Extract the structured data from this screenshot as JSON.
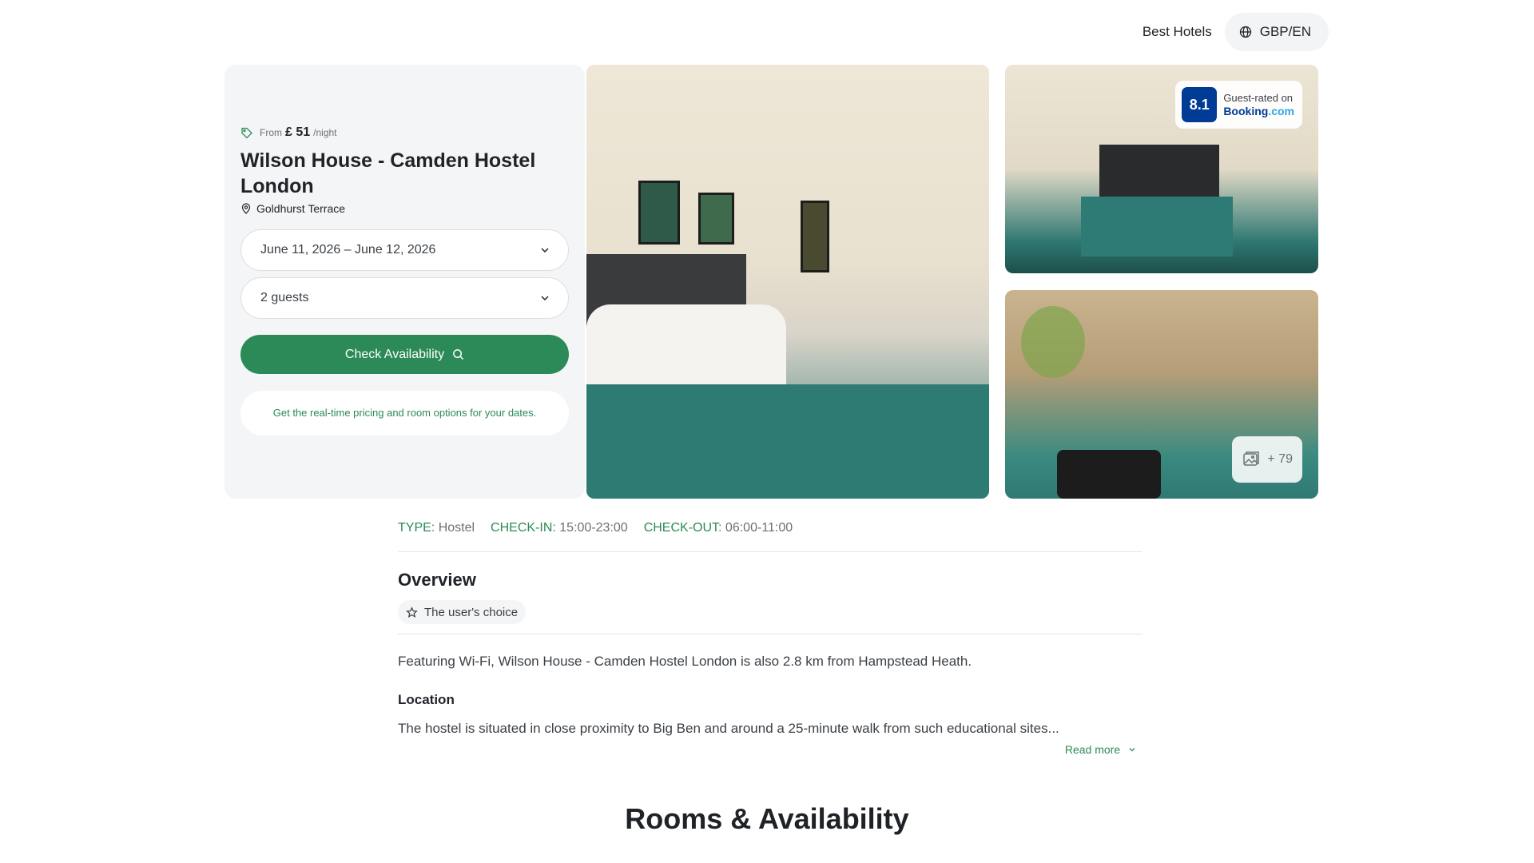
{
  "header": {
    "best_hotels_label": "Best Hotels",
    "currency_lang_label": "GBP/EN"
  },
  "hotel": {
    "price_prefix": "From",
    "price": "£ 51",
    "price_suffix": "/night",
    "name": "Wilson House - Camden Hostel London",
    "address": "Goldhurst Terrace"
  },
  "booking_form": {
    "dates_value": "June 11, 2026 – June 12, 2026",
    "guests_value": "2 guests",
    "check_button_label": "Check Availability",
    "pricing_note": "Get the real-time pricing and room options for your dates."
  },
  "gallery": {
    "rating_score": "8.1",
    "rating_caption": "Guest-rated on",
    "rating_brand_main": "Booking",
    "rating_brand_suffix": ".com",
    "more_photos_label": "+ 79"
  },
  "meta": {
    "type_key": "TYPE",
    "type_value": ": Hostel",
    "checkin_key": "CHECK-IN",
    "checkin_value": ": 15:00-23:00",
    "checkout_key": "CHECK-OUT",
    "checkout_value": ": 06:00-11:00"
  },
  "overview": {
    "title": "Overview",
    "chip_label": "The user's choice",
    "description": "Featuring Wi-Fi, Wilson House - Camden Hostel London is also 2.8 km from Hampstead Heath.",
    "location_title": "Location",
    "location_text": "The hostel is situated in close proximity to Big Ben and around a 25-minute walk from such educational sites...",
    "read_more_label": "Read more"
  },
  "rooms": {
    "title": "Rooms & Availability"
  },
  "colors": {
    "accent_green": "#2b8a57",
    "booking_blue": "#003b95",
    "panel_bg": "#f4f5f6"
  }
}
